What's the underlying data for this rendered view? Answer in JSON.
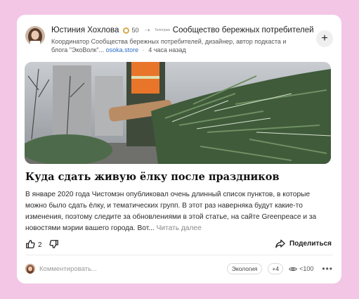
{
  "post": {
    "author_name": "Юстиния Хохлова",
    "karma": "50",
    "community_prefix": "Телеграм",
    "community_name": "Сообщество бережных потребителей",
    "author_desc": "Координатор Сообщества бережных потребителей, дизайнер, автор подкаста и блога \"ЭкоВолк\"...",
    "author_link": "osoka.store",
    "time_ago": "4 часа назад",
    "subscribe_symbol": "+",
    "title": "Куда сдать живую ёлку после праздников",
    "body": "В январе 2020 года Чистомэн опубликовал очень длинный список пунктов, в которые можно было сдать ёлку, и тематических групп. В этот раз наверняка будут какие-то изменения, поэтому следите за обновлениями в этой статье, на сайте Greenpeace и за новостями мэрии вашего города. Вот...",
    "read_more": "Читать далее"
  },
  "actions": {
    "like_count": "2",
    "share_label": "Поделиться"
  },
  "footer": {
    "comment_placeholder": "Комментировать...",
    "tag": "Экология",
    "more_tags": "+4",
    "views": "<100",
    "more": "•••"
  },
  "icons": [
    "like-icon",
    "dislike-icon",
    "share-icon",
    "eye-icon",
    "more-icon",
    "plus-icon"
  ],
  "colors": {
    "background": "#f3c6e6",
    "card": "#ffffff",
    "link": "#2f6fc6",
    "karma": "#d6a84a"
  }
}
